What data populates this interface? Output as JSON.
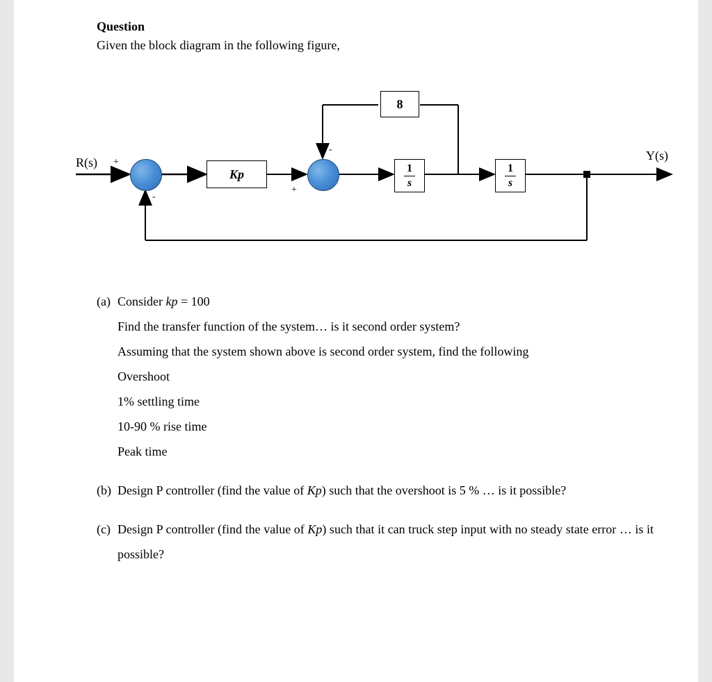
{
  "heading": "Question",
  "intro": "Given the block diagram in the following figure,",
  "diagram": {
    "input_label": "R(s)",
    "output_label": "Y(s)",
    "sum1_plus": "+",
    "sum1_minus": "-",
    "sum2_plus": "+",
    "sum2_minus": "-",
    "block_kp": "Kp",
    "block_feedback": "8",
    "block_g1_num": "1",
    "block_g1_den": "s",
    "block_g2_num": "1",
    "block_g2_den": "s"
  },
  "parts": {
    "a_marker": "(a)",
    "a_line1_pre": "Consider ",
    "a_line1_var": "kp",
    "a_line1_post": " = 100",
    "a_line2": "Find the transfer function of the system…   is it second order system?",
    "a_line3": "Assuming that the system shown above is second order system, find the following",
    "a_line4": "Overshoot",
    "a_line5": "1% settling time",
    "a_line6": "10-90 % rise time",
    "a_line7": "Peak time",
    "b_marker": "(b)",
    "b_text_pre": "Design P controller (find the value of ",
    "b_text_var": "Kp",
    "b_text_post": ") such that the overshoot is 5 % …   is it possible?",
    "c_marker": "(c)",
    "c_text_pre": "Design P controller (find the value of ",
    "c_text_var": "Kp",
    "c_text_post": ")  such that it can truck step input with no steady state error … is it possible?"
  }
}
